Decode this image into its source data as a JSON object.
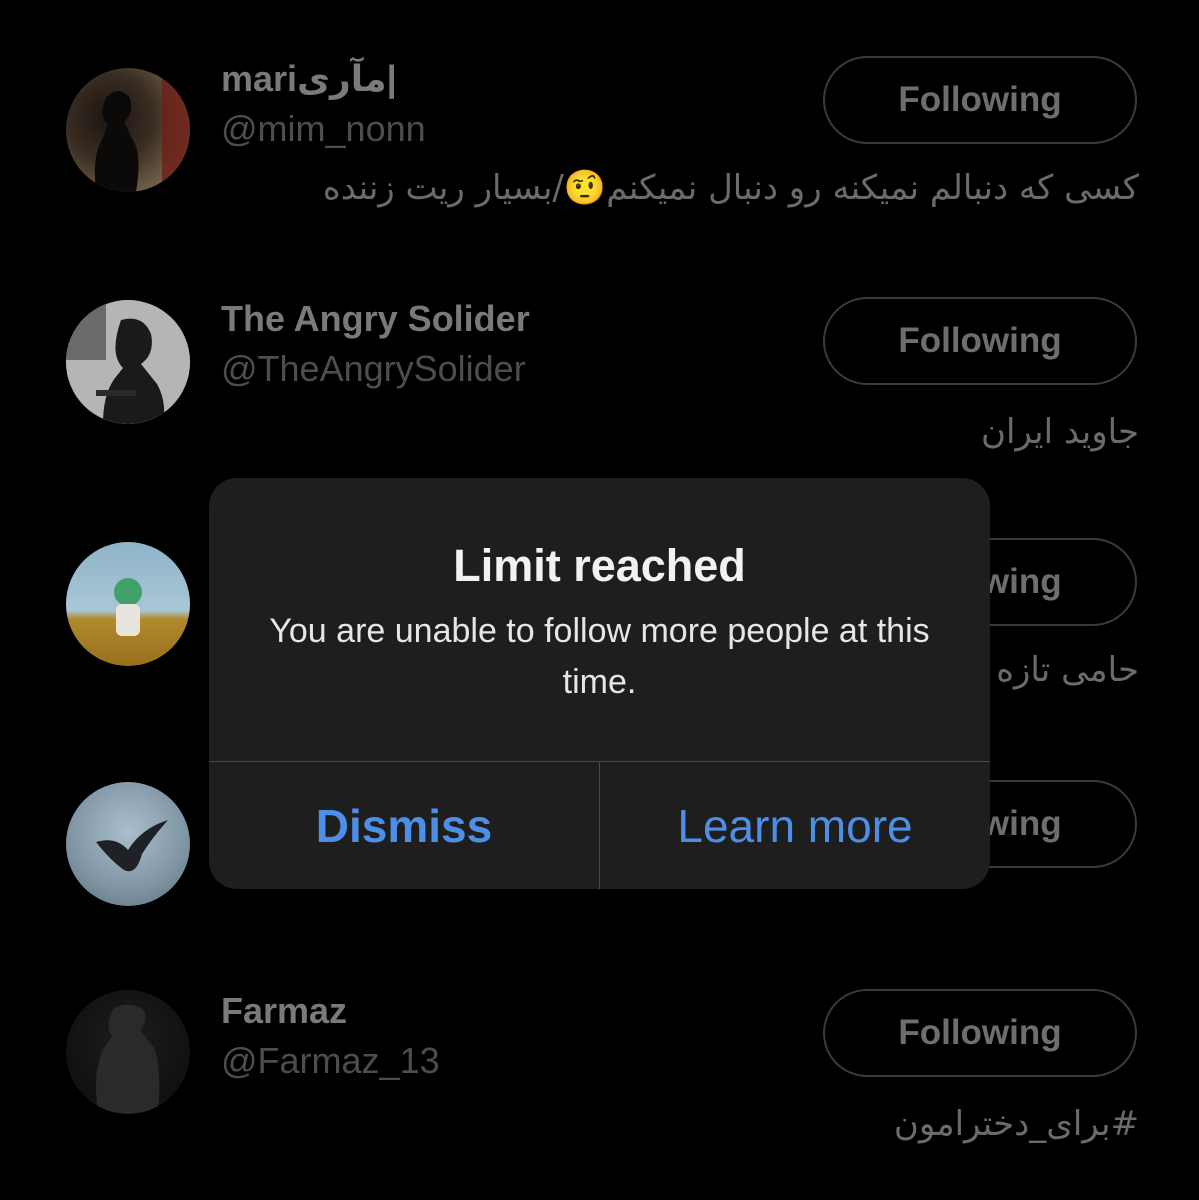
{
  "users": [
    {
      "name": "mariمآری|",
      "handle": "@mim_nonn",
      "button": "Following",
      "bio": "کسی که دنبالم نمیکنه رو دنبال نمیکنم🤨/بسیار ریت زننده"
    },
    {
      "name": "The Angry Solider",
      "handle": "@TheAngrySolider",
      "button": "Following",
      "bio": "جاوید ایران"
    },
    {
      "name": "",
      "handle": "",
      "button": "Following",
      "bio": "حامی تازه"
    },
    {
      "name": "",
      "handle": "",
      "button": "Following",
      "bio": ""
    },
    {
      "name": "Farmaz",
      "handle": "@Farmaz_13",
      "button": "Following",
      "bio": "#برای_دخترامون"
    }
  ],
  "dialog": {
    "title": "Limit reached",
    "message": "You are unable to follow more people at this time.",
    "dismiss_label": "Dismiss",
    "learn_more_label": "Learn more"
  },
  "colors": {
    "background": "#000000",
    "dialog_bg": "#1e1e1e",
    "link_blue": "#4d8fe6"
  }
}
